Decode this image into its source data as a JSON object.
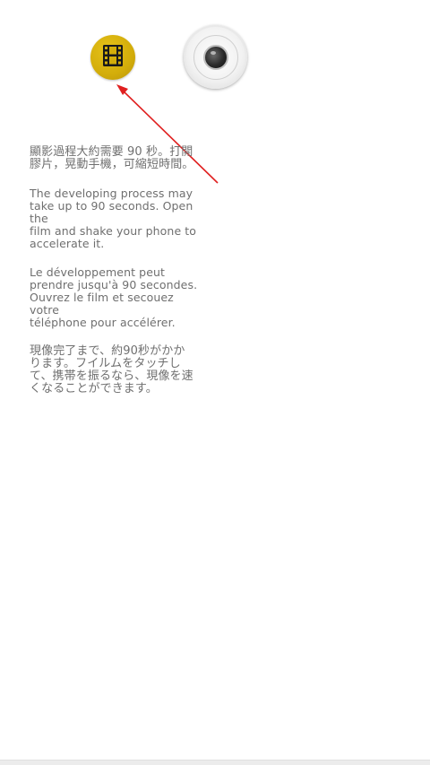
{
  "icons": {
    "film": "film-strip-icon",
    "camera": "camera-shutter-icon",
    "arrow": "pointer-arrow-icon"
  },
  "colors": {
    "film_button": "#d3ad0a",
    "arrow": "#e02020",
    "text": "#6f6f6f",
    "background": "#ffffff"
  },
  "instructions": {
    "chinese": "顯影過程大約需要 90 秒。打開\n膠片，晃動手機，可縮短時間。",
    "english": "The developing process may\ntake up to 90 seconds. Open the\nfilm and shake your phone to\naccelerate it.",
    "french": "Le développement peut\nprendre jusqu'à 90 secondes.\nOuvrez le film et secouez votre\ntéléphone pour accélérer.",
    "japanese": "現像完了まで、約90秒がかか\nります。フイルムをタッチし\nて、携帯を振るなら、現像を速\nくなることができます。"
  }
}
